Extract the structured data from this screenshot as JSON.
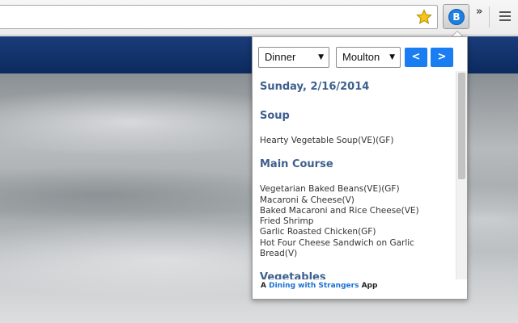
{
  "browser": {
    "star_icon": "star-icon",
    "extension_logo": "B",
    "overflow_icon": "»",
    "menu_icon": "hamburger-icon"
  },
  "popup": {
    "meal_select": {
      "value": "Dinner",
      "caret": "▼"
    },
    "hall_select": {
      "value": "Moulton",
      "caret": "▼"
    },
    "prev_label": "<",
    "next_label": ">",
    "date": "Sunday, 2/16/2014",
    "sections": [
      {
        "title": "Soup",
        "items": [
          "Hearty Vegetable Soup(VE)(GF)"
        ]
      },
      {
        "title": "Main Course",
        "items": [
          "Vegetarian Baked Beans(VE)(GF)",
          "Macaroni & Cheese(V)",
          "Baked Macaroni and Rice Cheese(VE)",
          "Fried Shrimp",
          "Garlic Roasted Chicken(GF)",
          "Hot Four Cheese Sandwich on Garlic",
          "Bread(V)"
        ]
      },
      {
        "title": "Vegetables",
        "items": []
      }
    ],
    "footer": {
      "prefix": "A",
      "link": "Dining with Strangers",
      "suffix": "App"
    }
  },
  "colors": {
    "accent": "#1a7ef2",
    "heading": "#3e5f8e",
    "site_header": "#0c2a5f"
  }
}
